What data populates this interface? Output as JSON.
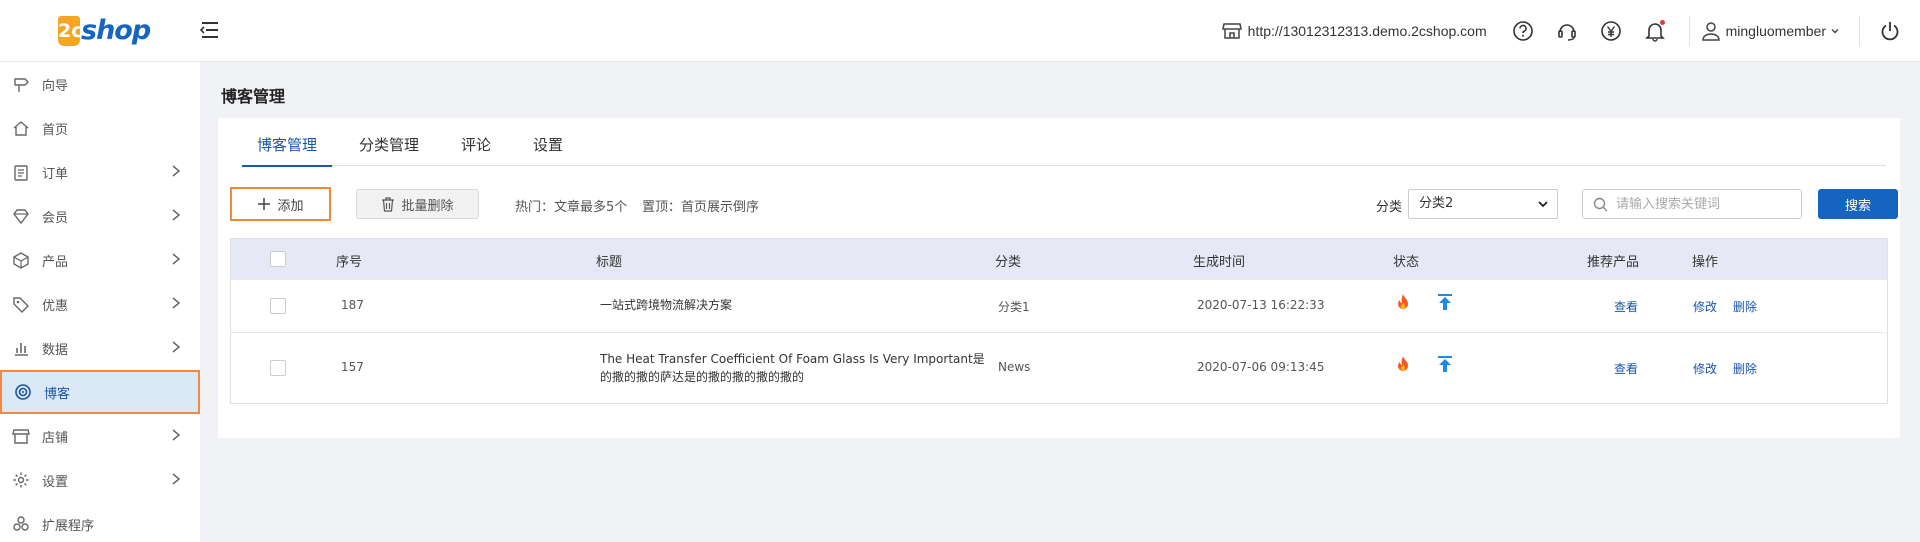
{
  "header": {
    "logo_badge": "2c",
    "logo_word": "shop",
    "shop_url": "http://13012312313.demo.2cshop.com",
    "username": "mingluomember"
  },
  "sidebar": {
    "items": [
      {
        "label": "向导",
        "icon": "signpost-icon",
        "has_children": false
      },
      {
        "label": "首页",
        "icon": "home-icon",
        "has_children": false
      },
      {
        "label": "订单",
        "icon": "clipboard-icon",
        "has_children": true
      },
      {
        "label": "会员",
        "icon": "diamond-icon",
        "has_children": true
      },
      {
        "label": "产品",
        "icon": "box-icon",
        "has_children": true
      },
      {
        "label": "优惠",
        "icon": "tag-icon",
        "has_children": true
      },
      {
        "label": "数据",
        "icon": "bar-chart-icon",
        "has_children": true
      },
      {
        "label": "博客",
        "icon": "target-icon",
        "has_children": false,
        "active": true
      },
      {
        "label": "店铺",
        "icon": "store-icon",
        "has_children": true
      },
      {
        "label": "设置",
        "icon": "gear-icon",
        "has_children": true
      },
      {
        "label": "扩展程序",
        "icon": "extension-icon",
        "has_children": false
      }
    ]
  },
  "page": {
    "title": "博客管理",
    "tabs": [
      "博客管理",
      "分类管理",
      "评论",
      "设置"
    ],
    "active_tab": 0
  },
  "toolbar": {
    "add_label": "添加",
    "bulk_delete_label": "批量删除",
    "hint_hot": "热门：文章最多5个",
    "hint_top": "置顶：首页展示倒序",
    "category_label": "分类",
    "category_selected": "分类2",
    "search_placeholder": "请输入搜索关键词",
    "search_label": "搜索"
  },
  "table": {
    "columns": [
      "序号",
      "标题",
      "分类",
      "生成时间",
      "状态",
      "推荐产品",
      "操作"
    ],
    "rows": [
      {
        "id": "187",
        "title": "一站式跨境物流解决方案",
        "category": "分类1",
        "created": "2020-07-13 16:22:33",
        "view": "查看",
        "edit": "修改",
        "delete": "删除"
      },
      {
        "id": "157",
        "title": "The Heat Transfer Coefficient Of Foam Glass Is Very Important是的撒的撒的萨达是的撒的撒的撒的撒的",
        "category": "News",
        "created": "2020-07-06 09:13:45",
        "view": "查看",
        "edit": "修改",
        "delete": "删除"
      }
    ]
  },
  "colors": {
    "brand_blue": "#1565c0",
    "logo_orange": "#f5a623",
    "highlight_orange": "#f0893b",
    "hot_red": "#ff5722",
    "top_blue": "#1e88e5"
  }
}
